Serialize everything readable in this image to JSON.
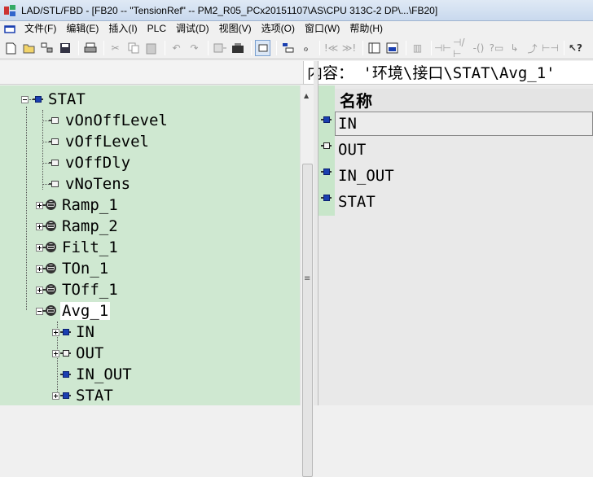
{
  "window": {
    "title": "LAD/STL/FBD  - [FB20 -- \"TensionRef\" -- PM2_R05_PCx20151107\\AS\\CPU 313C-2 DP\\...\\FB20]"
  },
  "menu": {
    "items": [
      "文件(F)",
      "编辑(E)",
      "插入(I)",
      "PLC",
      "调试(D)",
      "视图(V)",
      "选项(O)",
      "窗口(W)",
      "帮助(H)"
    ]
  },
  "toolbar": {
    "icons": [
      "new-icon",
      "open-icon",
      "accessible-nodes-icon",
      "save-icon",
      "print-icon",
      "cut-icon",
      "copy-icon",
      "paste-icon",
      "undo-icon",
      "redo-icon",
      "load-icon",
      "monitor-icon",
      "interface-icon",
      "symbol-icon",
      "addresses-icon",
      "previous-icon",
      "next-icon",
      "overview-icon",
      "details-icon",
      "network-icon",
      "normally-open-icon",
      "normally-closed-icon",
      "coil-icon",
      "box-icon",
      "branch-open-icon",
      "branch-close-icon",
      "connection-icon",
      "help-icon"
    ]
  },
  "content_header": {
    "text": "内容： '环境\\接口\\STAT\\Avg_1'"
  },
  "tree": {
    "root": "STAT",
    "items": [
      {
        "label": "vOnOffLevel",
        "kind": "var"
      },
      {
        "label": "vOffLevel",
        "kind": "var"
      },
      {
        "label": "vOffDly",
        "kind": "var"
      },
      {
        "label": "vNoTens",
        "kind": "var"
      },
      {
        "label": "Ramp_1",
        "kind": "struct"
      },
      {
        "label": "Ramp_2",
        "kind": "struct"
      },
      {
        "label": "Filt_1",
        "kind": "struct"
      },
      {
        "label": "TOn_1",
        "kind": "struct"
      },
      {
        "label": "TOff_1",
        "kind": "struct"
      },
      {
        "label": "Avg_1",
        "kind": "struct",
        "expanded": true,
        "selected": true
      }
    ],
    "avg_children": [
      "IN",
      "OUT",
      "IN_OUT",
      "STAT"
    ]
  },
  "detail": {
    "column_header": "名称",
    "rows": [
      "IN",
      "OUT",
      "IN_OUT",
      "STAT"
    ]
  },
  "colors": {
    "tree_bg": "#cfe8d1",
    "accent_blue": "#1a3fb0"
  }
}
